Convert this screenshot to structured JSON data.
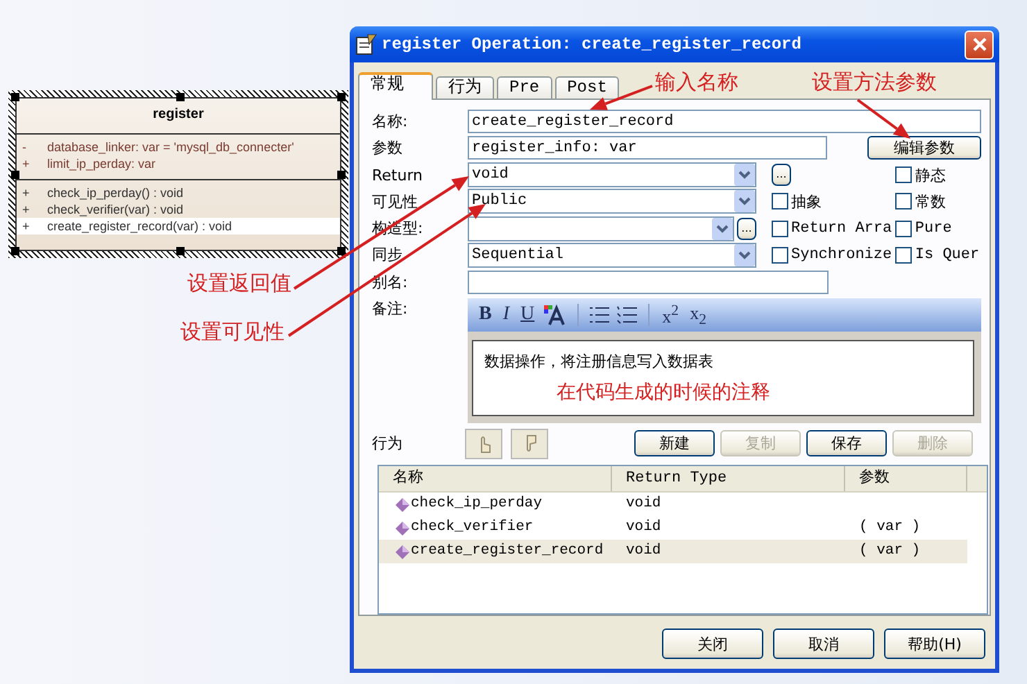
{
  "uml_class": {
    "name": "register",
    "attributes": [
      {
        "visibility": "-",
        "text": "database_linker:  var = 'mysql_db_connecter'"
      },
      {
        "visibility": "+",
        "text": "limit_ip_perday:  var"
      }
    ],
    "operations": [
      {
        "visibility": "+",
        "text": "check_ip_perday() : void",
        "selected": false
      },
      {
        "visibility": "+",
        "text": "check_verifier(var) : void",
        "selected": false
      },
      {
        "visibility": "+",
        "text": "create_register_record(var) : void",
        "selected": true
      }
    ]
  },
  "dialog": {
    "title": "register Operation: create_register_record",
    "tabs": [
      {
        "label": "常规",
        "selected": true
      },
      {
        "label": "行为",
        "selected": false
      },
      {
        "label": "Pre",
        "selected": false
      },
      {
        "label": "Post",
        "selected": false
      }
    ],
    "rows": [
      {
        "kind": "text",
        "label": "名称:",
        "value": "create_register_record"
      },
      {
        "kind": "text",
        "label": "参数",
        "value": "register_info: var",
        "button": {
          "label": "编辑参数"
        }
      },
      {
        "kind": "combo",
        "label": "Return",
        "value": "void",
        "extras": [
          {
            "kind": "button",
            "label": "..."
          },
          {
            "kind": "checkbox",
            "label": "静态",
            "checked": false
          }
        ]
      },
      {
        "kind": "combo",
        "label": "可见性",
        "value": "Public",
        "extras": [
          {
            "kind": "checkbox",
            "label": "抽象",
            "checked": false
          },
          {
            "kind": "checkbox",
            "label": "常数",
            "checked": false
          }
        ]
      },
      {
        "kind": "combo",
        "label": "构造型:",
        "button": {
          "label": "..."
        },
        "extras": [
          {
            "kind": "checkbox",
            "label": "Return Arra",
            "checked": false
          },
          {
            "kind": "checkbox",
            "label": "Pure",
            "checked": false
          }
        ]
      },
      {
        "kind": "combo",
        "label": "同步",
        "value": "Sequential",
        "extras": [
          {
            "kind": "checkbox",
            "label": "Synchronize",
            "checked": false
          },
          {
            "kind": "checkbox",
            "label": "Is Quer",
            "checked": false
          }
        ]
      },
      {
        "kind": "text",
        "label": "别名:"
      }
    ],
    "notes": {
      "label": "备注:",
      "toolbar": [
        {
          "kind": "bold",
          "label": "B"
        },
        {
          "kind": "italic",
          "label": "I"
        },
        {
          "kind": "underline",
          "label": "U"
        },
        {
          "kind": "font-color"
        },
        {
          "kind": "separator"
        },
        {
          "kind": "bullets"
        },
        {
          "kind": "numbering"
        },
        {
          "kind": "separator"
        },
        {
          "kind": "text",
          "label": "x$^{2}$"
        },
        {
          "kind": "text",
          "label": "x$_{2}$"
        }
      ],
      "text": "数据操作，将注册信息写入数据表"
    },
    "actions": {
      "label": "行为",
      "buttons": [
        {
          "label": "新建",
          "disabled": false
        },
        {
          "label": "复制",
          "disabled": true
        },
        {
          "label": "保存",
          "disabled": false
        },
        {
          "label": "删除",
          "disabled": true
        }
      ]
    },
    "list": {
      "columns": [
        "名称",
        "Return Type",
        "参数"
      ],
      "rows": [
        {
          "name": "check_ip_perday",
          "return_type": "void",
          "params": "",
          "selected": false
        },
        {
          "name": "check_verifier",
          "return_type": "void",
          "params": "( var )",
          "selected": false
        },
        {
          "name": "create_register_record",
          "return_type": "void",
          "params": "( var )",
          "selected": true
        }
      ]
    },
    "footer_buttons": [
      "关闭",
      "取消",
      "帮助(H)"
    ]
  },
  "annotations": [
    {
      "text": "输入名称"
    },
    {
      "text": "设置方法参数"
    },
    {
      "text": "设置返回值"
    },
    {
      "text": "设置可见性"
    },
    {
      "text": "在代码生成的时候的注释"
    }
  ]
}
